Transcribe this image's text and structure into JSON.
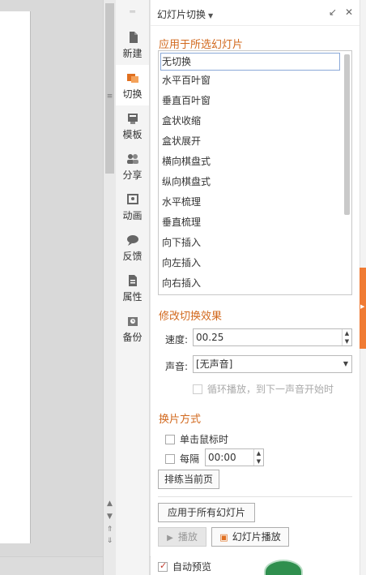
{
  "strip": {
    "items": [
      {
        "label": "新建",
        "icon": "new-file-icon"
      },
      {
        "label": "切换",
        "icon": "transition-icon"
      },
      {
        "label": "模板",
        "icon": "template-icon"
      },
      {
        "label": "分享",
        "icon": "share-icon"
      },
      {
        "label": "动画",
        "icon": "animation-icon"
      },
      {
        "label": "反馈",
        "icon": "feedback-icon"
      },
      {
        "label": "属性",
        "icon": "properties-icon"
      },
      {
        "label": "备份",
        "icon": "backup-icon"
      }
    ],
    "active_index": 1
  },
  "panel": {
    "title": "幻灯片切换",
    "apply_section": "应用于所选幻灯片",
    "transitions": [
      "无切换",
      "水平百叶窗",
      "垂直百叶窗",
      "盒状收缩",
      "盒状展开",
      "横向棋盘式",
      "纵向棋盘式",
      "水平梳理",
      "垂直梳理",
      "向下插入",
      "向左插入",
      "向右插入"
    ],
    "selected_transition": "无切换",
    "modify_section": "修改切换效果",
    "speed_label": "速度:",
    "speed_value": "00.25",
    "sound_label": "声音:",
    "sound_value": "[无声音]",
    "loop_label": "循环播放，到下一声音开始时",
    "advance_section": "换片方式",
    "on_click_label": "单击鼠标时",
    "every_label": "每隔",
    "every_value": "00:00",
    "rehearse_label": "排练当前页",
    "apply_all_label": "应用于所有幻灯片",
    "play_label": "播放",
    "slideshow_label": "幻灯片播放",
    "auto_preview_label": "自动预览"
  },
  "colors": {
    "accent_orange": "#d2691e",
    "edge_tab": "#f07b34"
  }
}
